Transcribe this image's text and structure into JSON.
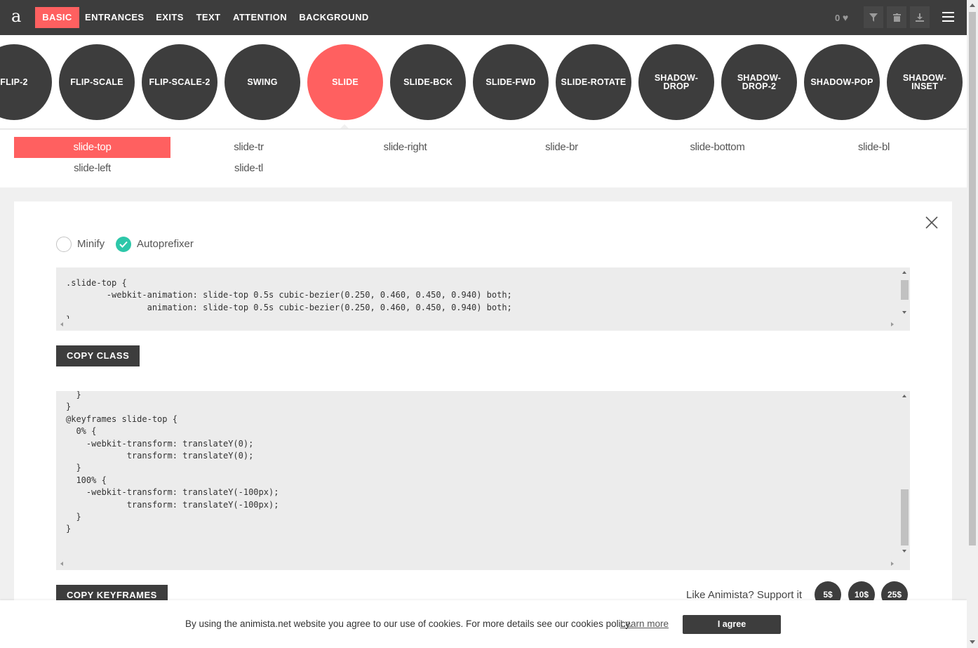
{
  "app": {
    "logo": "a",
    "nav": [
      {
        "label": "BASIC",
        "active": true
      },
      {
        "label": "ENTRANCES",
        "active": false
      },
      {
        "label": "EXITS",
        "active": false
      },
      {
        "label": "TEXT",
        "active": false
      },
      {
        "label": "ATTENTION",
        "active": false
      },
      {
        "label": "BACKGROUND",
        "active": false
      }
    ],
    "favorites_count": "0",
    "tools": [
      "filter-icon",
      "trash-icon",
      "download-icon",
      "menu-icon"
    ]
  },
  "animations": [
    {
      "label": "FLIP-2",
      "active": false
    },
    {
      "label": "FLIP-SCALE",
      "active": false
    },
    {
      "label": "FLIP-SCALE-2",
      "active": false
    },
    {
      "label": "SWING",
      "active": false
    },
    {
      "label": "SLIDE",
      "active": true
    },
    {
      "label": "SLIDE-BCK",
      "active": false
    },
    {
      "label": "SLIDE-FWD",
      "active": false
    },
    {
      "label": "SLIDE-ROTATE",
      "active": false
    },
    {
      "label": "SHADOW-DROP",
      "active": false
    },
    {
      "label": "SHADOW-DROP-2",
      "active": false
    },
    {
      "label": "SHADOW-POP",
      "active": false
    },
    {
      "label": "SHADOW-INSET",
      "active": false
    }
  ],
  "variants": [
    {
      "label": "slide-top",
      "active": true
    },
    {
      "label": "slide-tr",
      "active": false
    },
    {
      "label": "slide-right",
      "active": false
    },
    {
      "label": "slide-br",
      "active": false
    },
    {
      "label": "slide-bottom",
      "active": false
    },
    {
      "label": "slide-bl",
      "active": false
    },
    {
      "label": "slide-left",
      "active": false
    },
    {
      "label": "slide-tl",
      "active": false
    }
  ],
  "options": {
    "minify_label": "Minify",
    "minify_checked": false,
    "autoprefixer_label": "Autoprefixer",
    "autoprefixer_checked": true
  },
  "class_code": ".slide-top {\n\t-webkit-animation: slide-top 0.5s cubic-bezier(0.250, 0.460, 0.450, 0.940) both;\n\t        animation: slide-top 0.5s cubic-bezier(0.250, 0.460, 0.450, 0.940) both;\n}",
  "keyframes_code": "  }\n}\n@keyframes slide-top {\n  0% {\n    -webkit-transform: translateY(0);\n            transform: translateY(0);\n  }\n  100% {\n    -webkit-transform: translateY(-100px);\n            transform: translateY(-100px);\n  }\n}",
  "buttons": {
    "copy_class": "COPY CLASS",
    "copy_keyframes": "COPY KEYFRAMES"
  },
  "support": {
    "text": "Like Animista? Support it",
    "amounts": [
      "5$",
      "10$",
      "25$"
    ]
  },
  "cookie": {
    "text": "By using the animista.net website you agree to our use of cookies. For more details see our cookies policy.",
    "link": "Learn more",
    "agree": "I agree"
  },
  "colors": {
    "accent": "#ff6060",
    "dark": "#3d3d3d",
    "check": "#2dc7a9"
  }
}
